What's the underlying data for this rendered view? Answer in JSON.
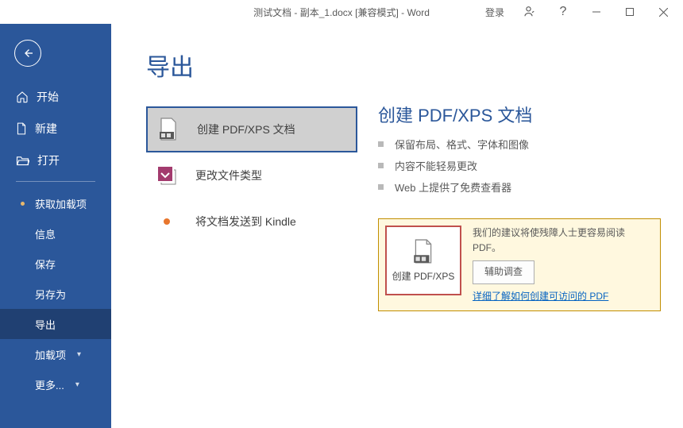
{
  "titlebar": {
    "title": "测试文档 - 副本_1.docx [兼容模式]  -  Word",
    "login": "登录"
  },
  "page": {
    "title": "导出"
  },
  "sidebar": {
    "primary": [
      {
        "label": "开始"
      },
      {
        "label": "新建"
      },
      {
        "label": "打开"
      }
    ],
    "secondary": [
      {
        "label": "获取加载项",
        "bullet": true
      },
      {
        "label": "信息"
      },
      {
        "label": "保存"
      },
      {
        "label": "另存为"
      },
      {
        "label": "导出",
        "selected": true
      },
      {
        "label": "加载项",
        "caret": true
      },
      {
        "label": "更多...",
        "caret": true
      }
    ]
  },
  "export_options": {
    "pdf": "创建 PDF/XPS 文档",
    "change_type": "更改文件类型",
    "kindle": "将文档发送到 Kindle"
  },
  "detail": {
    "title": "创建 PDF/XPS 文档",
    "bullets": [
      "保留布局、格式、字体和图像",
      "内容不能轻易更改",
      "Web 上提供了免费查看器"
    ]
  },
  "panel": {
    "create_btn": "创建 PDF/XPS",
    "info": "我们的建议将使残障人士更容易阅读 PDF。",
    "assist_btn": "辅助调查",
    "link": "详细了解如何创建可访问的 PDF"
  }
}
